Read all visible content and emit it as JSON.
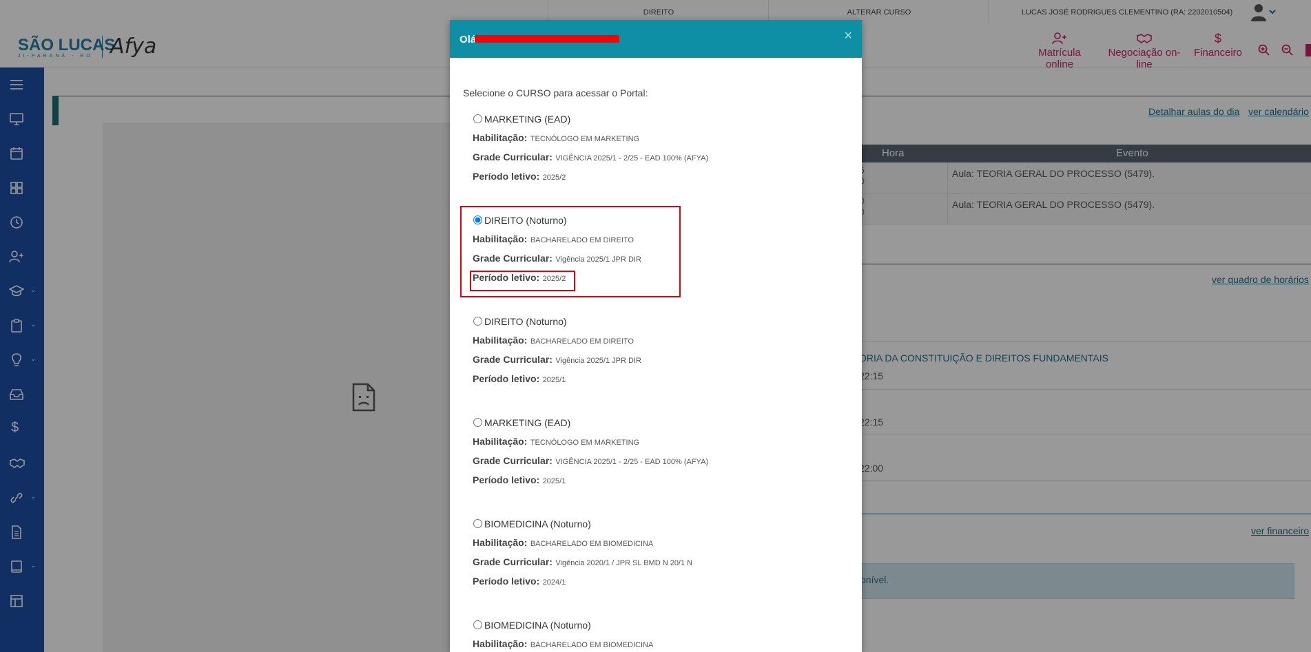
{
  "topbar": {
    "course": "DIREITO",
    "change_course": "ALTERAR CURSO",
    "user": "LUCAS JOSÉ RODRIGUES CLEMENTINO (RA: 2202010504)"
  },
  "header": {
    "logo_name": "SÃO LUCAS",
    "logo_sub": "JI-PARANÁ - RO",
    "logo_partner": "Afya",
    "links": [
      {
        "label": "Matrícula online",
        "icon": "add-user-icon"
      },
      {
        "label": "Negociação on-line",
        "icon": "handshake-icon"
      },
      {
        "label": "Financeiro",
        "icon": "dollar-icon"
      }
    ],
    "accent_color": "#cf1f6a"
  },
  "sidebar": {
    "color": "#1e4fa6",
    "items": [
      {
        "icon": "menu-icon",
        "expand": false
      },
      {
        "icon": "monitor-icon",
        "expand": false
      },
      {
        "icon": "calendar-icon",
        "expand": false
      },
      {
        "icon": "grid-icon",
        "expand": false
      },
      {
        "icon": "clock-icon",
        "expand": false
      },
      {
        "icon": "add-user-icon",
        "expand": false
      },
      {
        "icon": "graduation-cap-icon",
        "expand": true
      },
      {
        "icon": "clipboard-icon",
        "expand": true
      },
      {
        "icon": "lightbulb-icon",
        "expand": true
      },
      {
        "icon": "inbox-icon",
        "expand": false
      },
      {
        "icon": "dollar-icon",
        "expand": false
      },
      {
        "icon": "handshake-icon",
        "expand": false
      },
      {
        "icon": "link-icon",
        "expand": true
      },
      {
        "icon": "document-icon",
        "expand": false
      },
      {
        "icon": "book-icon",
        "expand": true
      },
      {
        "icon": "layout-icon",
        "expand": false
      }
    ]
  },
  "background": {
    "links": {
      "detail_classes": "Detalhar aulas do dia",
      "calendar": "ver calendário",
      "schedule": "ver quadro de horários",
      "financial": "ver financeiro"
    },
    "table": {
      "headers": [
        "Hora",
        "Evento"
      ],
      "rows": [
        {
          "hora_top": "5",
          "hora_bottom": "0",
          "event": "Aula: TEORIA GERAL DO PROCESSO (5479)."
        },
        {
          "hora_top": "0",
          "hora_bottom": "0",
          "event": "Aula: TEORIA GERAL DO PROCESSO (5479)."
        }
      ]
    },
    "schedule": {
      "subject": "ORIA DA CONSTITUIÇÃO E DIREITOS FUNDAMENTAIS",
      "times": [
        "22:15",
        "22:15",
        "22:00"
      ]
    },
    "info_text": "onível."
  },
  "modal": {
    "header_color": "#0e8fa5",
    "greeting": "Olá",
    "close": "×",
    "intro": "Selecione o CURSO para acessar o Portal:",
    "labels": {
      "habilitacao": "Habilitação:",
      "grade": "Grade Curricular:",
      "periodo": "Período letivo:"
    },
    "courses": [
      {
        "name": "MARKETING (EAD)",
        "habilitacao": "TECNÓLOGO EM MARKETING",
        "grade": "VIGÊNCIA 2025/1 - 2/25 - EAD 100% (AFYA)",
        "periodo": "2025/2",
        "selected": false
      },
      {
        "name": "DIREITO (Noturno)",
        "habilitacao": "BACHARELADO EM DIREITO",
        "grade": "Vigência 2025/1 JPR DIR",
        "periodo": "2025/2",
        "selected": true
      },
      {
        "name": "DIREITO (Noturno)",
        "habilitacao": "BACHARELADO EM DIREITO",
        "grade": "Vigência 2025/1 JPR DIR",
        "periodo": "2025/1",
        "selected": false
      },
      {
        "name": "MARKETING (EAD)",
        "habilitacao": "TECNÓLOGO EM MARKETING",
        "grade": "VIGÊNCIA 2025/1 - 2/25 - EAD 100% (AFYA)",
        "periodo": "2025/1",
        "selected": false
      },
      {
        "name": "BIOMEDICINA (Noturno)",
        "habilitacao": "BACHARELADO EM BIOMEDICINA",
        "grade": "Vigência 2020/1 / JPR SL BMD N 20/1 N",
        "periodo": "2024/1",
        "selected": false
      },
      {
        "name": "BIOMEDICINA (Noturno)",
        "habilitacao": "BACHARELADO EM BIOMEDICINA",
        "grade": "",
        "periodo": "",
        "selected": false
      }
    ]
  }
}
